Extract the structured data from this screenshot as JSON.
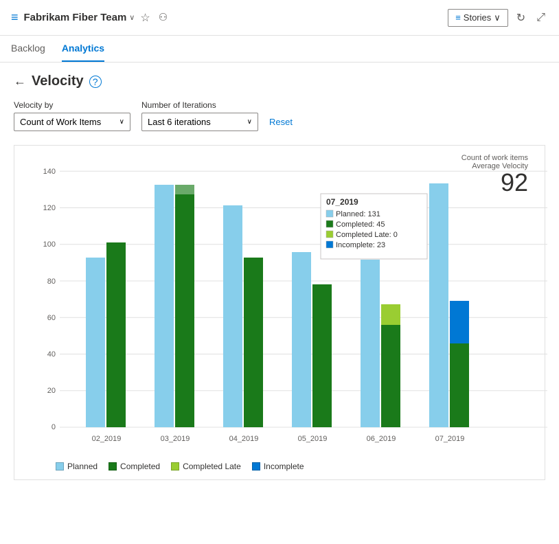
{
  "header": {
    "icon": "≡",
    "team_name": "Fabrikam Fiber Team",
    "chevron": "∨",
    "star_icon": "☆",
    "people_icon": "👥",
    "stories_label": "Stories",
    "refresh_icon": "↻",
    "expand_icon": "⤢"
  },
  "nav": {
    "tabs": [
      {
        "label": "Backlog",
        "active": false
      },
      {
        "label": "Analytics",
        "active": true
      }
    ]
  },
  "page": {
    "title": "Velocity",
    "back_icon": "←",
    "help_icon": "?"
  },
  "filters": {
    "velocity_by_label": "Velocity by",
    "velocity_by_value": "Count of Work Items",
    "iterations_label": "Number of Iterations",
    "iterations_value": "Last 6 iterations",
    "reset_label": "Reset"
  },
  "chart": {
    "count_label": "Count of work items",
    "avg_velocity_label": "Average Velocity",
    "avg_velocity_value": "92",
    "y_axis": [
      0,
      20,
      40,
      60,
      80,
      100,
      120,
      140
    ],
    "bars": [
      {
        "label": "02_2019",
        "planned": 91,
        "completed": 99,
        "completed_late": 0,
        "incomplete": 0
      },
      {
        "label": "03_2019",
        "planned": 130,
        "completed": 130,
        "completed_late": 0,
        "incomplete": 0
      },
      {
        "label": "04_2019",
        "planned": 119,
        "completed": 91,
        "completed_late": 0,
        "incomplete": 0
      },
      {
        "label": "05_2019",
        "planned": 94,
        "completed": 77,
        "completed_late": 0,
        "incomplete": 0
      },
      {
        "label": "06_2019",
        "planned": 90,
        "completed": 55,
        "completed_late": 11,
        "incomplete": 0
      },
      {
        "label": "07_2019",
        "planned": 131,
        "completed": 45,
        "completed_late": 0,
        "incomplete": 23
      }
    ],
    "tooltip": {
      "visible": true,
      "title": "07_2019",
      "rows": [
        {
          "label": "Planned: 131",
          "color": "#add8e6"
        },
        {
          "label": "Completed: 45",
          "color": "#1a7a1a"
        },
        {
          "label": "Completed Late: 0",
          "color": "#9acd32"
        },
        {
          "label": "Incomplete: 23",
          "color": "#0078d4"
        }
      ]
    },
    "legend": [
      {
        "label": "Planned",
        "color": "#87ceeb"
      },
      {
        "label": "Completed",
        "color": "#1a7a1a"
      },
      {
        "label": "Completed Late",
        "color": "#9acd32"
      },
      {
        "label": "Incomplete",
        "color": "#0078d4"
      }
    ]
  }
}
